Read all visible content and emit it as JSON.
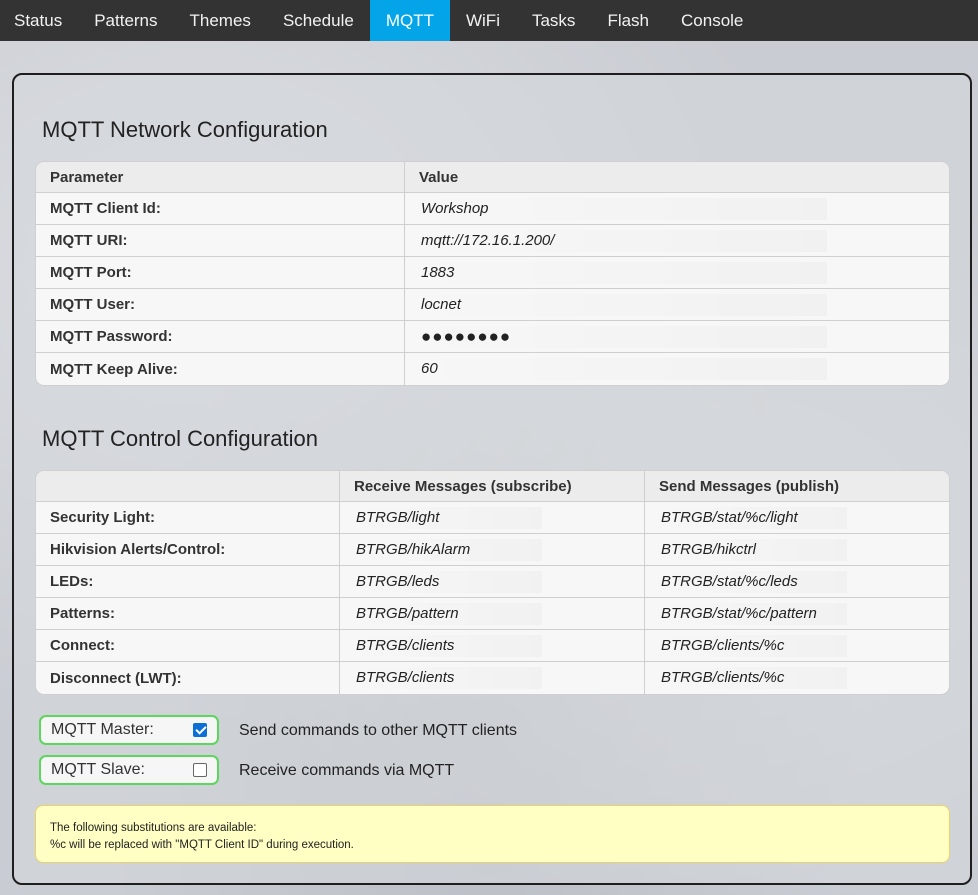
{
  "nav": {
    "items": [
      "Status",
      "Patterns",
      "Themes",
      "Schedule",
      "MQTT",
      "WiFi",
      "Tasks",
      "Flash",
      "Console"
    ],
    "active": "MQTT"
  },
  "network": {
    "title": "MQTT Network Configuration",
    "headers": [
      "Parameter",
      "Value"
    ],
    "rows": [
      {
        "label": "MQTT Client Id:",
        "value": "Workshop"
      },
      {
        "label": "MQTT URI:",
        "value": "mqtt://172.16.1.200/"
      },
      {
        "label": "MQTT Port:",
        "value": "1883"
      },
      {
        "label": "MQTT User:",
        "value": "locnet"
      },
      {
        "label": "MQTT Password:",
        "value": "●●●●●●●●"
      },
      {
        "label": "MQTT Keep Alive:",
        "value": "60"
      }
    ]
  },
  "control": {
    "title": "MQTT Control Configuration",
    "headers": [
      "",
      "Receive Messages (subscribe)",
      "Send Messages (publish)"
    ],
    "rows": [
      {
        "label": "Security Light:",
        "subscribe": "BTRGB/light",
        "publish": "BTRGB/stat/%c/light"
      },
      {
        "label": "Hikvision Alerts/Control:",
        "subscribe": "BTRGB/hikAlarm",
        "publish": "BTRGB/hikctrl"
      },
      {
        "label": "LEDs:",
        "subscribe": "BTRGB/leds",
        "publish": "BTRGB/stat/%c/leds"
      },
      {
        "label": "Patterns:",
        "subscribe": "BTRGB/pattern",
        "publish": "BTRGB/stat/%c/pattern"
      },
      {
        "label": "Connect:",
        "subscribe": "BTRGB/clients",
        "publish": "BTRGB/clients/%c"
      },
      {
        "label": "Disconnect (LWT):",
        "subscribe": "BTRGB/clients",
        "publish": "BTRGB/clients/%c"
      }
    ]
  },
  "options": {
    "master": {
      "label": "MQTT Master:",
      "checked": true,
      "description": "Send commands to other MQTT clients"
    },
    "slave": {
      "label": "MQTT Slave:",
      "checked": false,
      "description": "Receive commands via MQTT"
    }
  },
  "note": {
    "line1": "The following substitutions are available:",
    "line2": "%c will be replaced with \"MQTT Client ID\" during execution."
  },
  "colors": {
    "nav_bg": "#333333",
    "nav_active": "#04a4e8",
    "checkbox_border": "#5cd65c",
    "note_bg": "#ffffc4"
  }
}
